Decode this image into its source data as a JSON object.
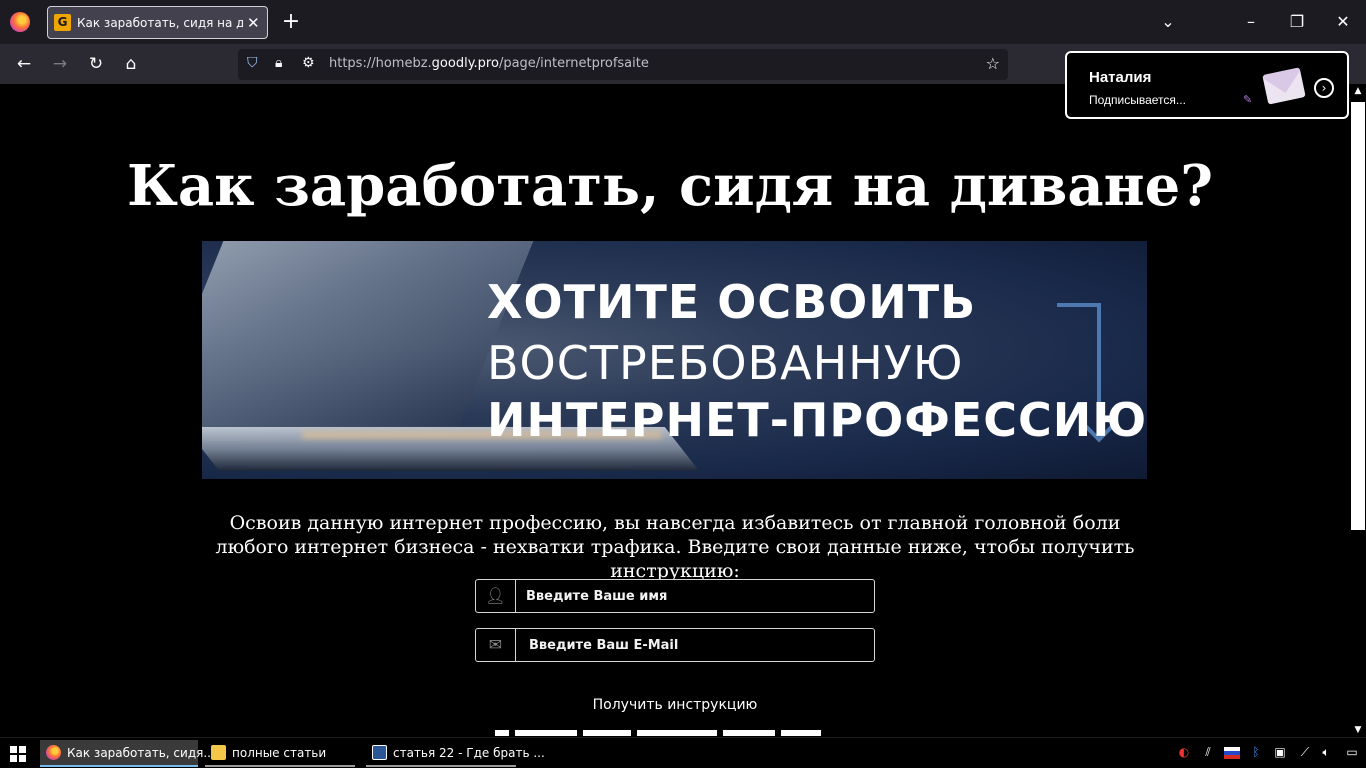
{
  "browser": {
    "tab_title": "Как заработать, сидя на диване?",
    "tab_favicon": "G",
    "new_tab_label": "+",
    "url_prefix": "https://homebz.",
    "url_host": "goodly.pro",
    "url_path": "/page/internetprofsaite"
  },
  "page": {
    "headline": "Как заработать, сидя на диване?",
    "banner": {
      "line1": "ХОТИТЕ ОСВОИТЬ",
      "line2": "ВОСТРЕБОВАННУЮ",
      "line3": "ИНТЕРНЕТ-ПРОФЕССИЮ?"
    },
    "description": "Освоив данную интернет профессию, вы навсегда избавитесь от главной головной боли любого интернет бизнеса - нехватки трафика. Введите свои данные ниже, чтобы получить инструкцию:",
    "form": {
      "name_placeholder": "Введите Ваше имя",
      "email_placeholder": "Введите Ваш E-Mail",
      "submit_label": "Получить инструкцию"
    }
  },
  "notification": {
    "name": "Наталия",
    "status": "Подписывается..."
  },
  "taskbar": {
    "items": [
      {
        "label": "Как заработать, сидя..."
      },
      {
        "label": "полные статьи"
      },
      {
        "label": "статья 22 - Где брать ..."
      }
    ]
  },
  "colors": {
    "page_bg": "#000000",
    "tab_bg": "#42414d",
    "toolbar_bg": "#2b2a33",
    "banner_bg": "#19294a"
  }
}
